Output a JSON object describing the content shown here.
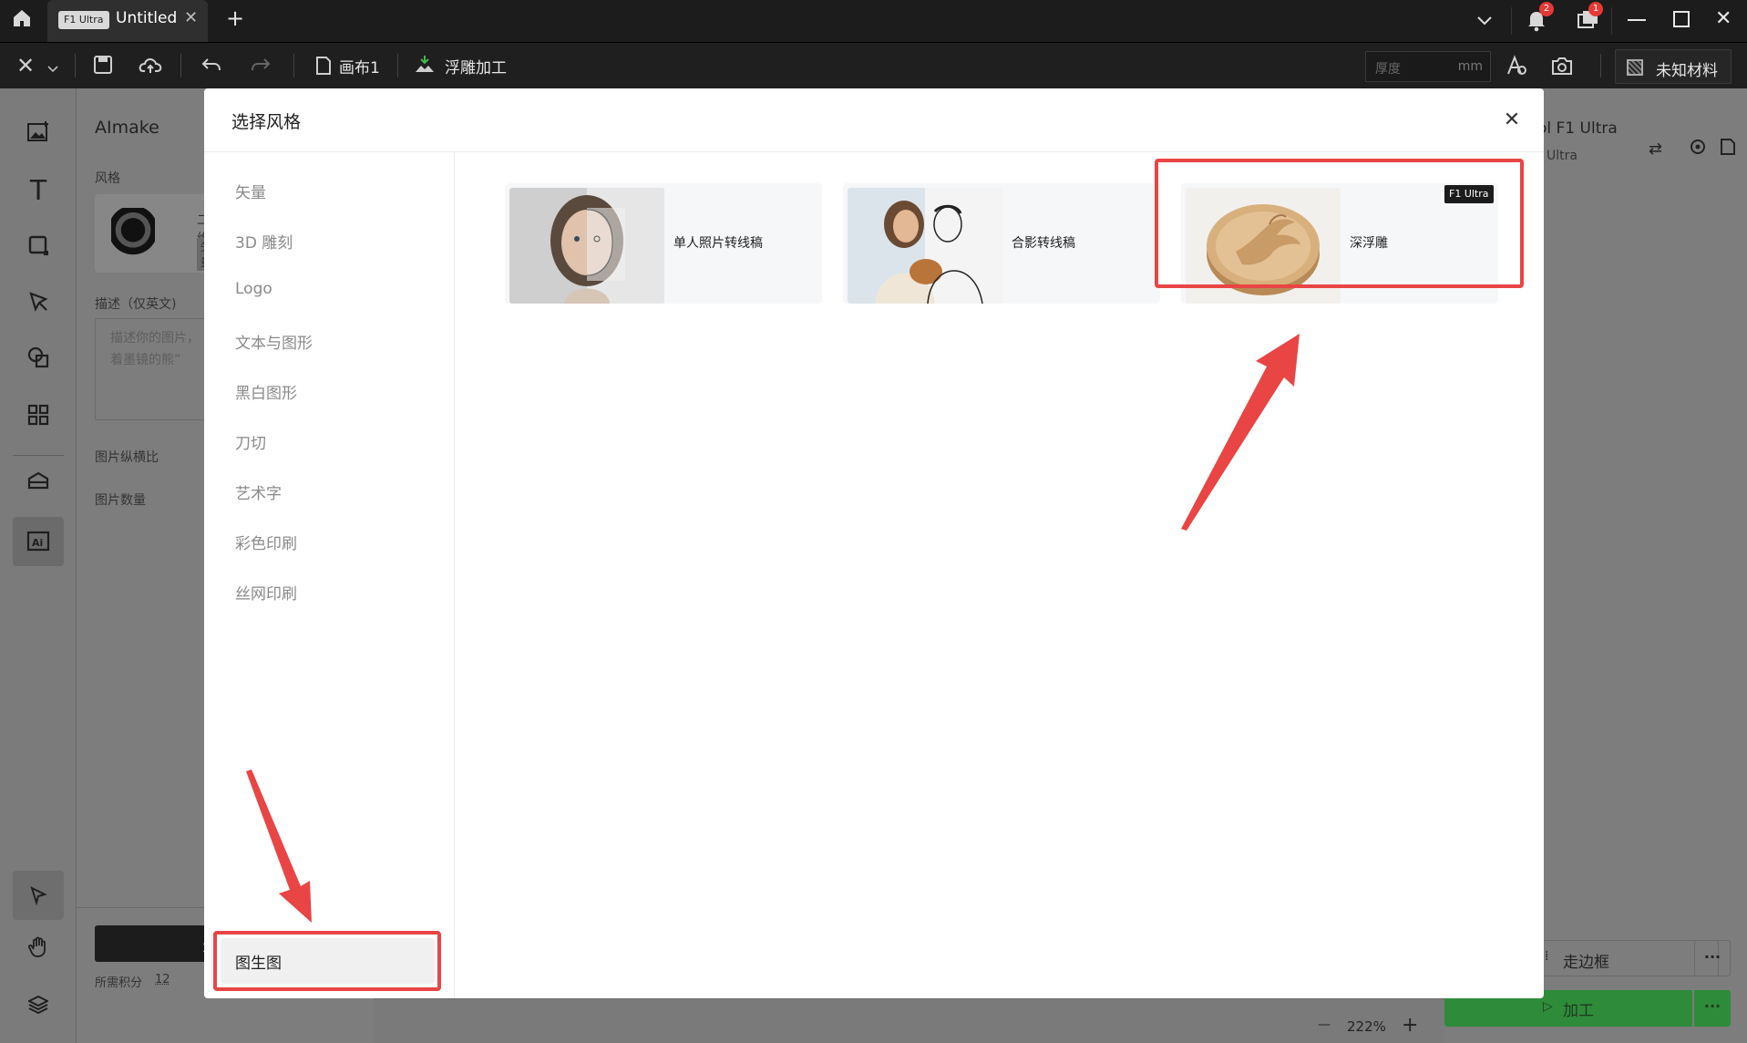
{
  "titlebar": {
    "model_badge": "F1 Ultra",
    "tab_title": "Untitled",
    "notifications_count": "2",
    "messages_count": "1"
  },
  "toolbar": {
    "canvas_label": "画布1",
    "mode_label": "浮雕加工",
    "thickness_placeholder": "厚度",
    "thickness_unit": "mm",
    "material_label": "未知材料"
  },
  "aipanel": {
    "title": "AImake",
    "style_label": "风格",
    "style_name": "二维",
    "style_tag": "矢量",
    "desc_label": "描述（仅英文)",
    "desc_placeholder_1": "描述你的图片，",
    "desc_placeholder_2": "着墨镜的熊”",
    "ratio_label": "图片纵横比",
    "count_label": "图片数量",
    "generate_char": "生",
    "credits_label": "所需积分",
    "credits_value": "12"
  },
  "rightpanel": {
    "device_name": "ol F1 Ultra",
    "device_sub": "Ultra",
    "frame_label": "走边框",
    "process_label": "加工",
    "more": "···"
  },
  "statusbar": {
    "zoom_minus": "—",
    "zoom_value": "222%",
    "zoom_plus": "+"
  },
  "modal": {
    "title": "选择风格",
    "categories": [
      "矢量",
      "3D 雕刻",
      "Logo",
      "文本与图形",
      "黑白图形",
      "刀切",
      "艺术字",
      "彩色印刷",
      "丝网印刷"
    ],
    "active_category": "图生图",
    "cards": [
      {
        "label": "单人照片转线稿"
      },
      {
        "label": "合影转线稿"
      },
      {
        "label": "深浮雕",
        "tag": "F1 Ultra"
      }
    ]
  },
  "colors": {
    "highlight": "#e94545",
    "process_green": "#2e8b3a"
  }
}
